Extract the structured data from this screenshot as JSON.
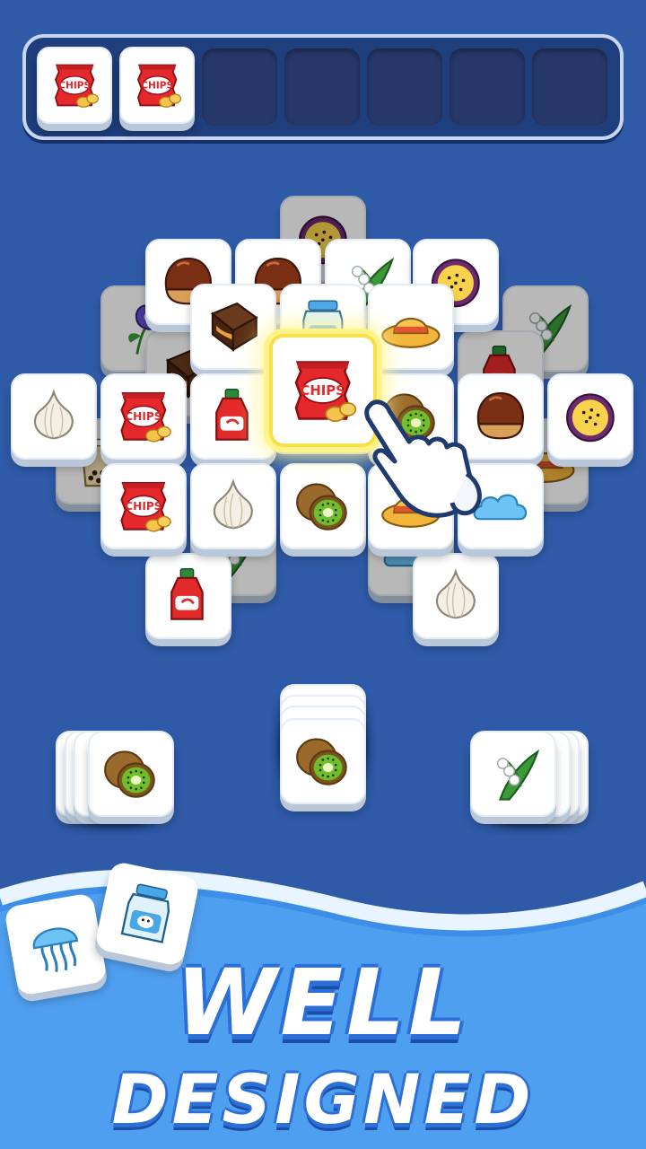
{
  "tray": {
    "slots": [
      {
        "item": "chips",
        "label": "CHIPS"
      },
      {
        "item": "chips",
        "label": "CHIPS"
      },
      {
        "item": ""
      },
      {
        "item": ""
      },
      {
        "item": ""
      },
      {
        "item": ""
      },
      {
        "item": ""
      }
    ]
  },
  "board": {
    "highlighted_tile": {
      "item": "chips",
      "label": "CHIPS"
    },
    "chips_label": "CHIPS"
  },
  "stacks": [
    {
      "item": "kiwi"
    },
    {
      "item": "kiwi"
    },
    {
      "item": "lily-of-the-valley"
    }
  ],
  "decor": {
    "tiles": [
      "jellyfish",
      "milk-jar"
    ]
  },
  "banner": {
    "line1": "WELL",
    "line2": "DESIGNED"
  },
  "colors": {
    "background": "#2f5aa8",
    "tray": "#1e3e7c",
    "highlight": "#f7e04a",
    "title_text": "#ffffff",
    "title_outline": "#2c6fd6"
  }
}
